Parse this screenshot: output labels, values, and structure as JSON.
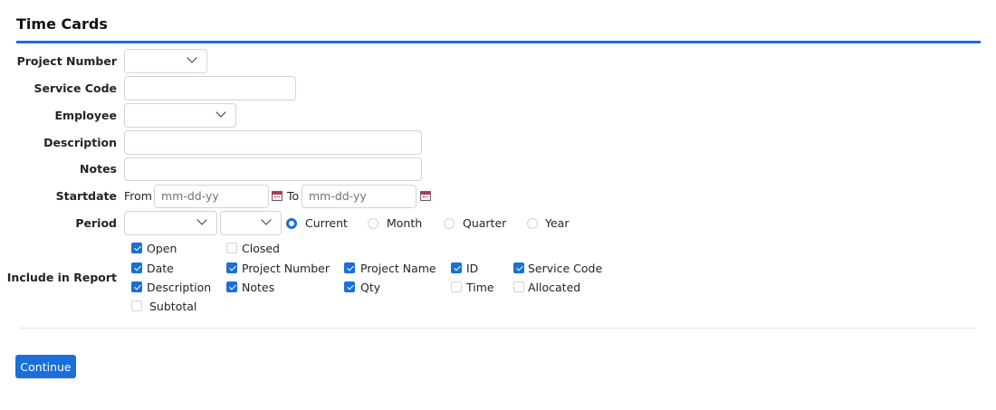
{
  "page": {
    "title": "Time Cards"
  },
  "form": {
    "project_number": {
      "label": "Project Number",
      "value": ""
    },
    "service_code": {
      "label": "Service Code",
      "value": ""
    },
    "employee": {
      "label": "Employee",
      "value": ""
    },
    "description": {
      "label": "Description",
      "value": ""
    },
    "notes": {
      "label": "Notes",
      "value": ""
    },
    "startdate": {
      "label": "Startdate",
      "from_label": "From",
      "from_placeholder": "mm-dd-yy",
      "to_label": "To",
      "to_placeholder": "mm-dd-yy"
    },
    "period": {
      "label": "Period",
      "select1": "",
      "select2": "",
      "options": [
        {
          "label": "Current",
          "selected": true
        },
        {
          "label": "Month",
          "selected": false
        },
        {
          "label": "Quarter",
          "selected": false
        },
        {
          "label": "Year",
          "selected": false
        }
      ]
    },
    "include": {
      "label": "Include in Report",
      "items": [
        {
          "label": "Open",
          "checked": true
        },
        {
          "label": "Closed",
          "checked": false
        },
        {
          "label": "Date",
          "checked": true
        },
        {
          "label": "Project Number",
          "checked": true
        },
        {
          "label": "Project Name",
          "checked": true
        },
        {
          "label": "ID",
          "checked": true
        },
        {
          "label": "Service Code",
          "checked": true
        },
        {
          "label": "Description",
          "checked": true
        },
        {
          "label": "Notes",
          "checked": true
        },
        {
          "label": "Qty",
          "checked": true
        },
        {
          "label": "Time",
          "checked": false
        },
        {
          "label": "Allocated",
          "checked": false
        },
        {
          "label": "Subtotal",
          "checked": false
        }
      ]
    }
  },
  "actions": {
    "continue_label": "Continue"
  },
  "colors": {
    "accent": "#1a6fd8"
  }
}
